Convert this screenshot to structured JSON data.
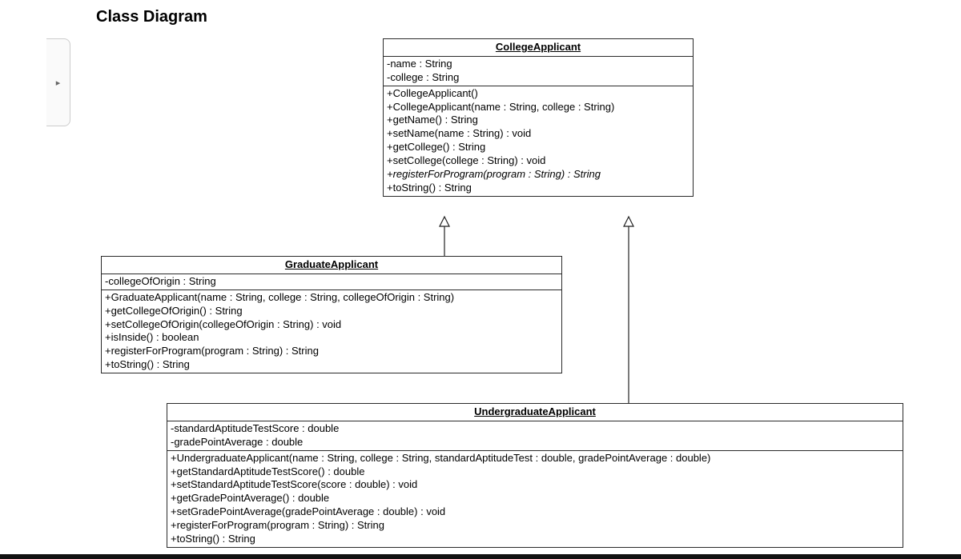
{
  "title": "Class Diagram",
  "sidebar_glyph": "▸",
  "classes": {
    "collegeApplicant": {
      "name": "CollegeApplicant",
      "attrs": [
        "-name : String",
        "-college : String"
      ],
      "methods": [
        "+CollegeApplicant()",
        "+CollegeApplicant(name : String, college : String)",
        "+getName() : String",
        "+setName(name : String) : void",
        "+getCollege() : String",
        "+setCollege(college : String) : void",
        {
          "text": "+registerForProgram(program : String) : String",
          "italic": true
        },
        "+toString() : String"
      ]
    },
    "graduateApplicant": {
      "name": "GraduateApplicant",
      "attrs": [
        "-collegeOfOrigin : String"
      ],
      "methods": [
        "+GraduateApplicant(name : String, college : String, collegeOfOrigin : String)",
        "+getCollegeOfOrigin() : String",
        "+setCollegeOfOrigin(collegeOfOrigin : String) : void",
        "+isInside() : boolean",
        "+registerForProgram(program : String) : String",
        "+toString() : String"
      ]
    },
    "undergraduateApplicant": {
      "name": "UndergraduateApplicant",
      "attrs": [
        "-standardAptitudeTestScore : double",
        "-gradePointAverage : double"
      ],
      "methods": [
        "+UndergraduateApplicant(name : String, college : String, standardAptitudeTest : double, gradePointAverage : double)",
        "+getStandardAptitudeTestScore() : double",
        "+setStandardAptitudeTestScore(score : double) : void",
        "+getGradePointAverage() : double",
        "+setGradePointAverage(gradePointAverage : double) : void",
        "+registerForProgram(program : String) : String",
        "+toString() : String"
      ]
    }
  }
}
